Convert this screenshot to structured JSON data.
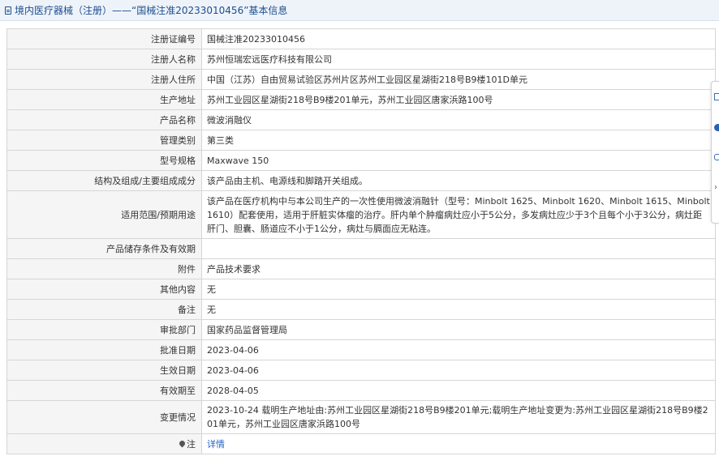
{
  "header": {
    "title": "境内医疗器械（注册）——“国械注准20233010456”基本信息"
  },
  "rows": [
    {
      "label": "注册证编号",
      "value": "国械注准20233010456"
    },
    {
      "label": "注册人名称",
      "value": "苏州恒瑞宏远医疗科技有限公司"
    },
    {
      "label": "注册人住所",
      "value": "中国（江苏）自由贸易试验区苏州片区苏州工业园区星湖街218号B9楼101D单元"
    },
    {
      "label": "生产地址",
      "value": "苏州工业园区星湖街218号B9楼201单元，苏州工业园区唐家浜路100号"
    },
    {
      "label": "产品名称",
      "value": "微波消融仪"
    },
    {
      "label": "管理类别",
      "value": "第三类"
    },
    {
      "label": "型号规格",
      "value": "Maxwave 150"
    },
    {
      "label": "结构及组成/主要组成成分",
      "value": "该产品由主机、电源线和脚踏开关组成。"
    },
    {
      "label": "适用范围/预期用途",
      "value": "该产品在医疗机构中与本公司生产的一次性使用微波消融针（型号：Minbolt 1625、Minbolt 1620、Minbolt 1615、Minbolt 1610）配套使用，适用于肝脏实体瘤的治疗。肝内单个肿瘤病灶应小于5公分，多发病灶应少于3个且每个小于3公分，病灶距肝门、胆囊、肠道应不小于1公分，病灶与膈面应无粘连。"
    },
    {
      "label": "产品储存条件及有效期",
      "value": ""
    },
    {
      "label": "附件",
      "value": "产品技术要求"
    },
    {
      "label": "其他内容",
      "value": "无"
    },
    {
      "label": "备注",
      "value": "无"
    },
    {
      "label": "审批部门",
      "value": "国家药品监督管理局"
    },
    {
      "label": "批准日期",
      "value": "2023-04-06"
    },
    {
      "label": "生效日期",
      "value": "2023-04-06"
    },
    {
      "label": "有效期至",
      "value": "2028-04-05"
    },
    {
      "label": "变更情况",
      "value": "2023-10-24 载明生产地址由:苏州工业园区星湖街218号B9楼201单元;载明生产地址变更为:苏州工业园区星湖街218号B9楼201单元，苏州工业园区唐家浜路100号"
    },
    {
      "label": "注",
      "value": "详情"
    }
  ],
  "colors": {
    "title_text": "#1c4e8e",
    "title_bg": "#eef3fa",
    "label_bg": "#f5f5f5",
    "border": "#d6d6d6",
    "link": "#1e64c8"
  },
  "icons": {
    "title": "document-icon",
    "note": "location-pin-icon",
    "side": [
      "document-icon",
      "circle-icon",
      "camera-icon",
      "chevron-right-icon"
    ]
  }
}
